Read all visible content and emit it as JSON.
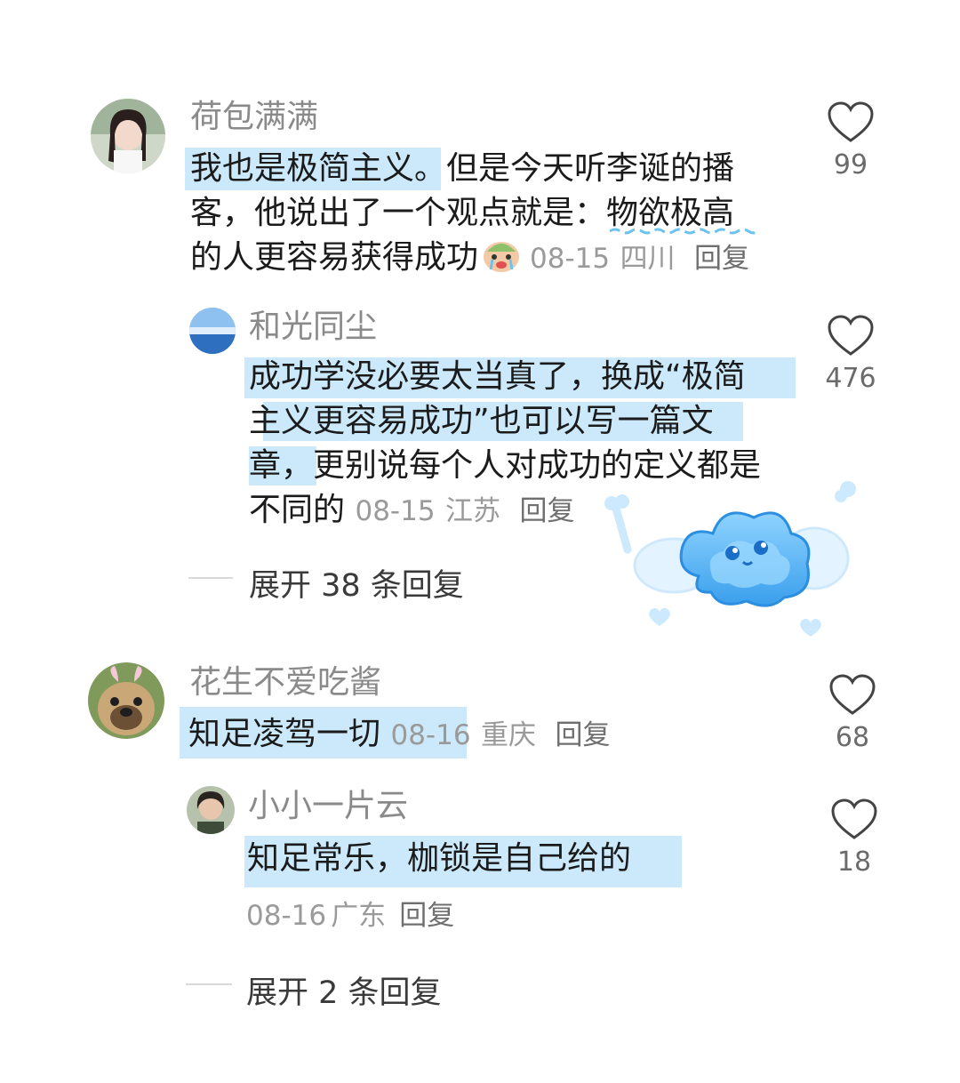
{
  "comments": [
    {
      "username": "荷包满满",
      "highlight_text": "我也是极简主义。",
      "text_rest_line1": "但是今天听李诞的播",
      "line2_a": "客，他说出了一个观点就是：",
      "line2_b": "物欲极高",
      "line3": "的人更容易获得成功",
      "emoji": "crying-face-emoji",
      "date": "08-15",
      "location": "四川",
      "reply_label": "回复",
      "likes": "99"
    },
    {
      "username": "和光同尘",
      "line1": "成功学没必要太当真了，换成“极简",
      "line2": "主义更容易成功”也可以写一篇文",
      "line3": "章，更别说每个人对成功的定义都是",
      "line4": "不同的",
      "date": "08-15",
      "location": "江苏",
      "reply_label": "回复",
      "likes": "476"
    },
    {
      "username": "花生不爱吃酱",
      "line1": "知足凌驾一切",
      "date": "08-16",
      "location": "重庆",
      "reply_label": "回复",
      "likes": "68"
    },
    {
      "username": "小小一片云",
      "line1": "知足常乐，枷锁是自己给的",
      "date": "08-16",
      "location": "广东",
      "reply_label": "回复",
      "likes": "18"
    }
  ],
  "expand": [
    "展开 38 条回复",
    "展开 2 条回复"
  ],
  "sticker": "blue-cloud-angel-sticker",
  "colors": {
    "highlight": "#a0d7f5",
    "username": "#8a8a8a",
    "meta": "#9a9a9a",
    "heart": "#444444"
  }
}
